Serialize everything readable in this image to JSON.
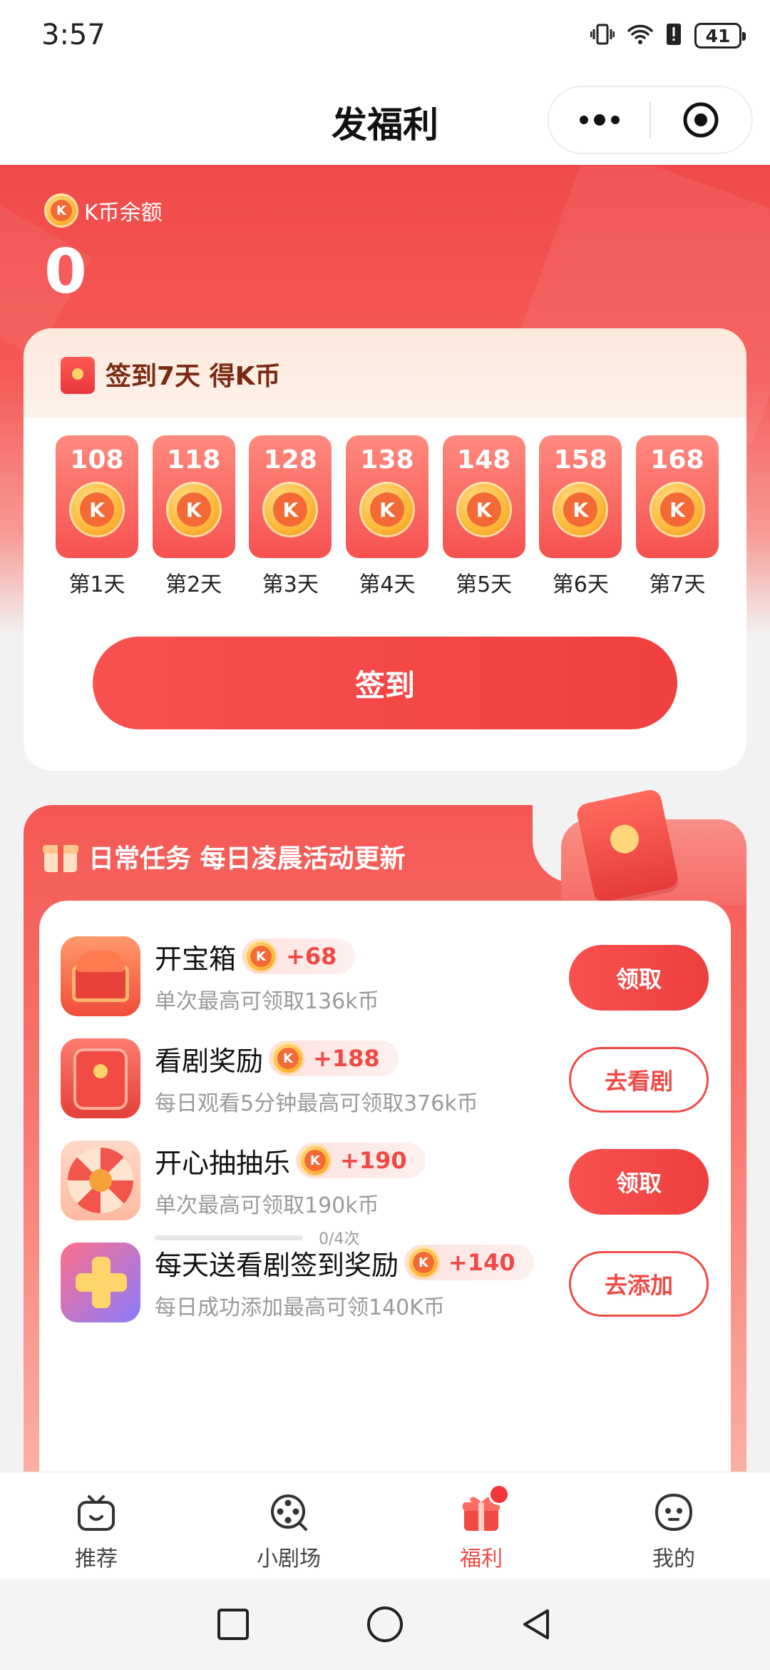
{
  "status_bar": {
    "time": "3:57",
    "battery": "41"
  },
  "title_bar": {
    "title": "发福利"
  },
  "balance": {
    "label": "K币余额",
    "value": "0"
  },
  "checkin": {
    "title": "签到7天 得K币",
    "days": [
      {
        "amount": "108",
        "label": "第1天"
      },
      {
        "amount": "118",
        "label": "第2天"
      },
      {
        "amount": "128",
        "label": "第3天"
      },
      {
        "amount": "138",
        "label": "第4天"
      },
      {
        "amount": "148",
        "label": "第5天"
      },
      {
        "amount": "158",
        "label": "第6天"
      },
      {
        "amount": "168",
        "label": "第7天"
      }
    ],
    "button": "签到"
  },
  "tasks": {
    "title": "日常任务 每日凌晨活动更新",
    "items": [
      {
        "name": "开宝箱",
        "reward": "+68",
        "desc": "单次最高可领取136k币",
        "button": "领取"
      },
      {
        "name": "看剧奖励",
        "reward": "+188",
        "desc": "每日观看5分钟最高可领取376k币",
        "button": "去看剧"
      },
      {
        "name": "开心抽抽乐",
        "reward": "+190",
        "desc": "单次最高可领取190k币",
        "progress": "0/4次",
        "button": "领取"
      },
      {
        "name": "每天送看剧签到奖励",
        "reward": "+140",
        "desc": "每日成功添加最高可领140K币",
        "button": "去添加"
      }
    ]
  },
  "tab_bar": {
    "tabs": [
      {
        "label": "推荐"
      },
      {
        "label": "小剧场"
      },
      {
        "label": "福利"
      },
      {
        "label": "我的"
      }
    ]
  },
  "coin_glyph": "K",
  "colors": {
    "accent": "#f04a45",
    "header_red": "#f04a4b",
    "coin_gold": "#ffb93a"
  }
}
